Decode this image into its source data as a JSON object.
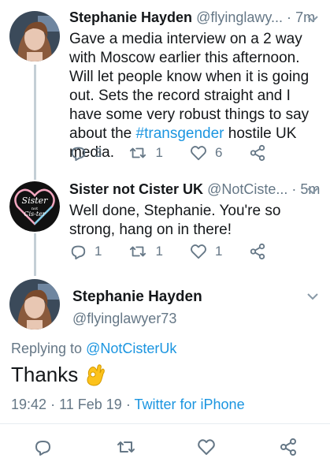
{
  "tweets": [
    {
      "name": "Stephanie Hayden",
      "handle": "@flyinglawy...",
      "separator": "·",
      "time": "7m",
      "text_before": "Gave a media interview on a 2 way with Moscow earlier this afternoon. Will let people know when it is going out. Sets the record straight and I have some very robust things to say about the ",
      "hashtag": "#transgender",
      "text_after": " hostile UK media.",
      "replies": "3",
      "retweets": "1",
      "likes": "6"
    },
    {
      "name": "Sister not Cister UK",
      "handle": "@NotCiste...",
      "separator": "·",
      "time": "5m",
      "text": "Well done, Stephanie. You're so strong, hang on in there!",
      "avatar_text": "Sister",
      "avatar_text2": "not",
      "avatar_text3": "Cis-ter",
      "replies": "1",
      "retweets": "1",
      "likes": "1"
    }
  ],
  "main_tweet": {
    "name": "Stephanie Hayden",
    "handle": "@flyinglawyer73",
    "replying_label": "Replying to",
    "replying_to": "@NotCisterUk",
    "text": "Thanks",
    "emoji": "ok-hand",
    "time": "19:42",
    "date": "11 Feb 19",
    "separator": "·",
    "source": "Twitter for iPhone"
  },
  "colors": {
    "link": "#1b95e0",
    "muted": "#657786",
    "text": "#14171a",
    "thread_line": "#c4cfd6",
    "divider": "#e6ecf0"
  }
}
